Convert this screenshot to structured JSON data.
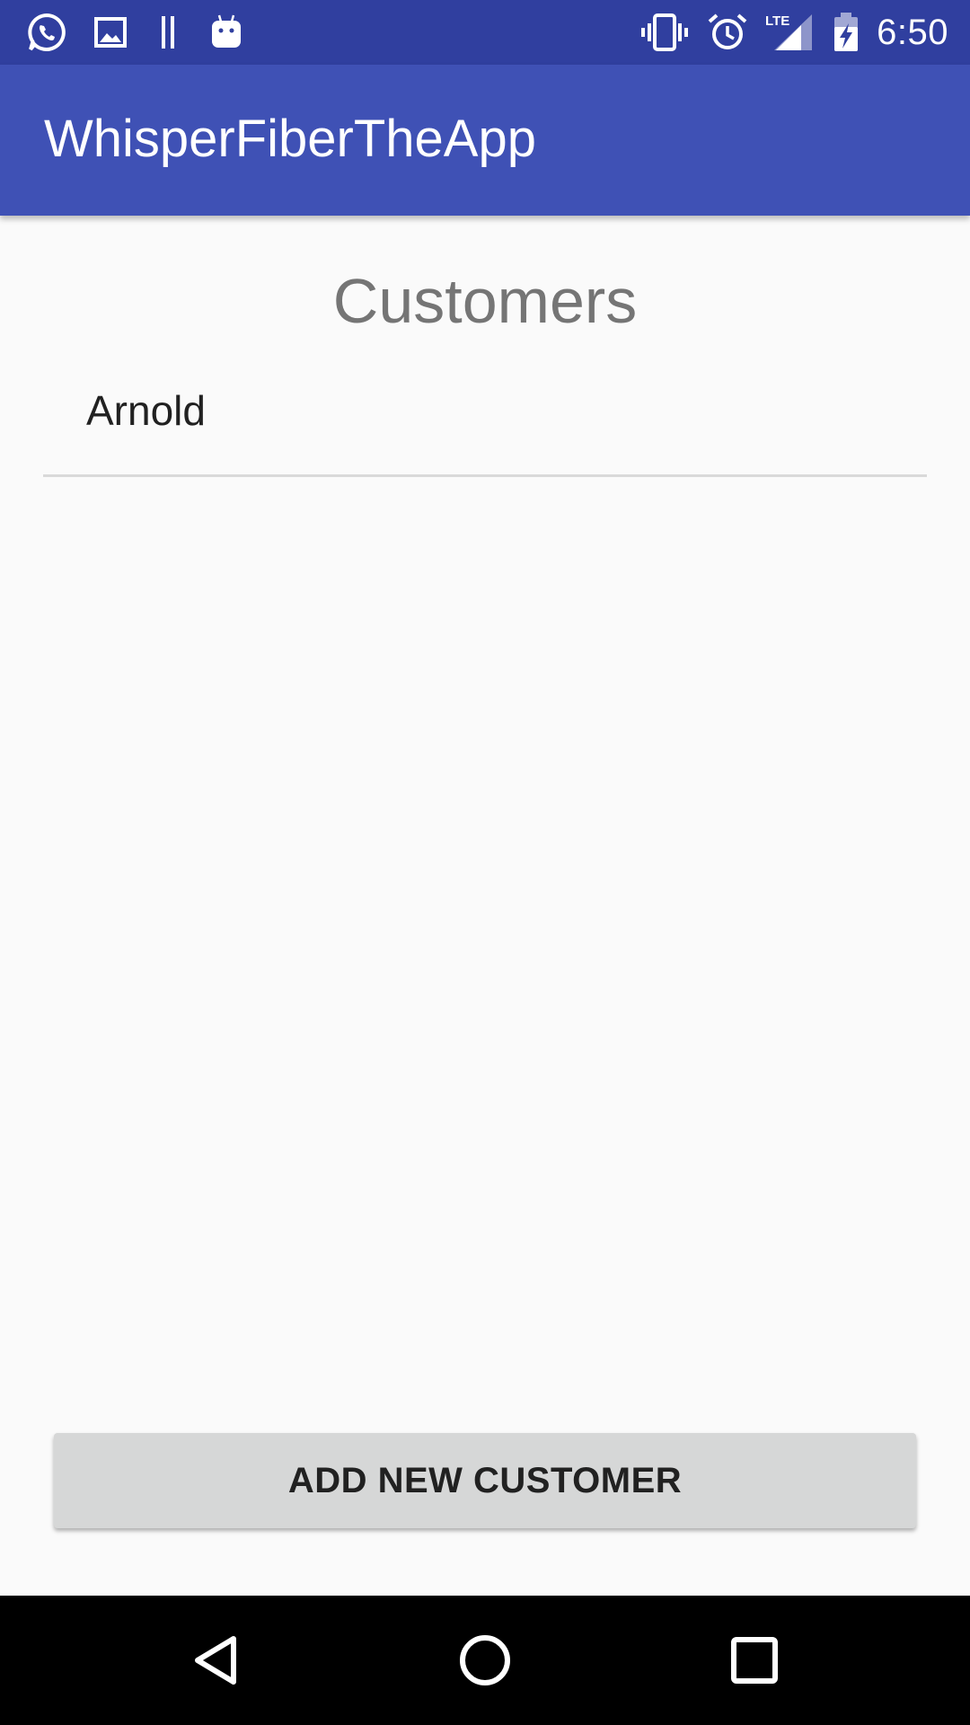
{
  "status_bar": {
    "time": "6:50",
    "network_label": "LTE",
    "left_icons": [
      "whatsapp-icon",
      "image-icon",
      "pause-icon",
      "android-icon"
    ],
    "right_icons": [
      "vibrate-icon",
      "alarm-icon",
      "lte-signal-icon",
      "battery-charging-icon"
    ]
  },
  "app_bar": {
    "title": "WhisperFiberTheApp"
  },
  "main": {
    "heading": "Customers",
    "customers": [
      {
        "name": "Arnold"
      }
    ],
    "add_button_label": "ADD NEW CUSTOMER"
  },
  "nav_bar": {
    "buttons": [
      "back-icon",
      "home-icon",
      "recents-icon"
    ]
  },
  "colors": {
    "status_bar": "#303f9f",
    "app_bar": "#3f51b5",
    "background": "#fafafa",
    "heading_text": "#757575",
    "button_bg": "#d6d7d7",
    "nav_bar": "#000000"
  }
}
